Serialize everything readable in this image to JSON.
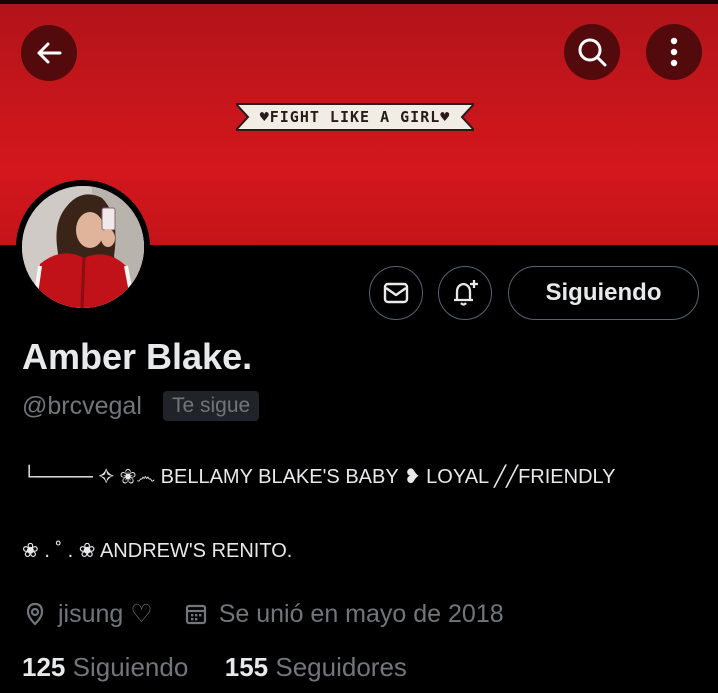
{
  "header": {
    "back_label": "Back",
    "search_label": "Search",
    "more_label": "More options",
    "banner_text": "♥FIGHT LIKE A GIRL♥"
  },
  "profile": {
    "display_name": "Amber Blake.",
    "handle": "@brcvegal",
    "follows_you": "Te sigue",
    "bio": {
      "line1": "└──── ✧ ❀෴ BELLAMY BLAKE'S BABY ❥ LOYAL ╱╱FRIENDLY",
      "line2": "❀ . ˚ . ❀ ANDREW'S RENITO."
    },
    "location": "jisung ♡",
    "joined": "Se unió en mayo de 2018",
    "following_count": "125",
    "following_label": "Siguiendo",
    "followers_count": "155",
    "followers_label": "Seguidores"
  },
  "actions": {
    "message_label": "Message",
    "notify_label": "Notifications",
    "following_button": "Siguiendo"
  },
  "colors": {
    "banner": "#c8161c",
    "background": "#000000",
    "text_primary": "#e7e9ea",
    "text_secondary": "#71767b",
    "border": "#536471"
  }
}
